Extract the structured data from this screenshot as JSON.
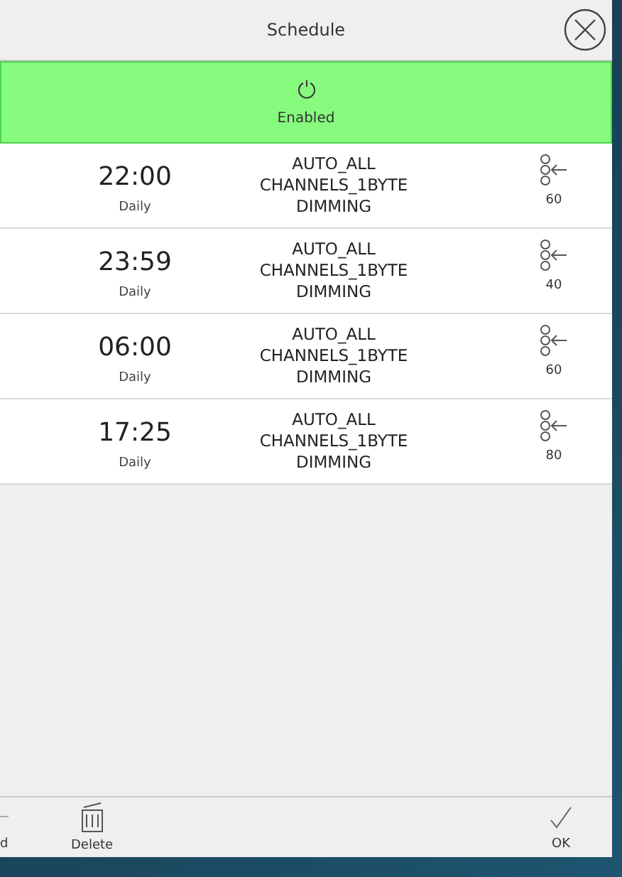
{
  "window": {
    "title": "Schedule"
  },
  "status": {
    "label": "Enabled",
    "enabled": true
  },
  "rows": [
    {
      "time": "22:00",
      "repeat": "Daily",
      "action": "AUTO_ALL\nCHANNELS_1BYTE\nDIMMING",
      "value": "60"
    },
    {
      "time": "23:59",
      "repeat": "Daily",
      "action": "AUTO_ALL\nCHANNELS_1BYTE\nDIMMING",
      "value": "40"
    },
    {
      "time": "06:00",
      "repeat": "Daily",
      "action": "AUTO_ALL\nCHANNELS_1BYTE\nDIMMING",
      "value": "60"
    },
    {
      "time": "17:25",
      "repeat": "Daily",
      "action": "AUTO_ALL\nCHANNELS_1BYTE\nDIMMING",
      "value": "80"
    }
  ],
  "toolbar": [
    {
      "kind": "add",
      "label": "d"
    },
    {
      "kind": "delete",
      "label": "Delete"
    },
    {
      "kind": "ok",
      "label": "OK"
    }
  ]
}
